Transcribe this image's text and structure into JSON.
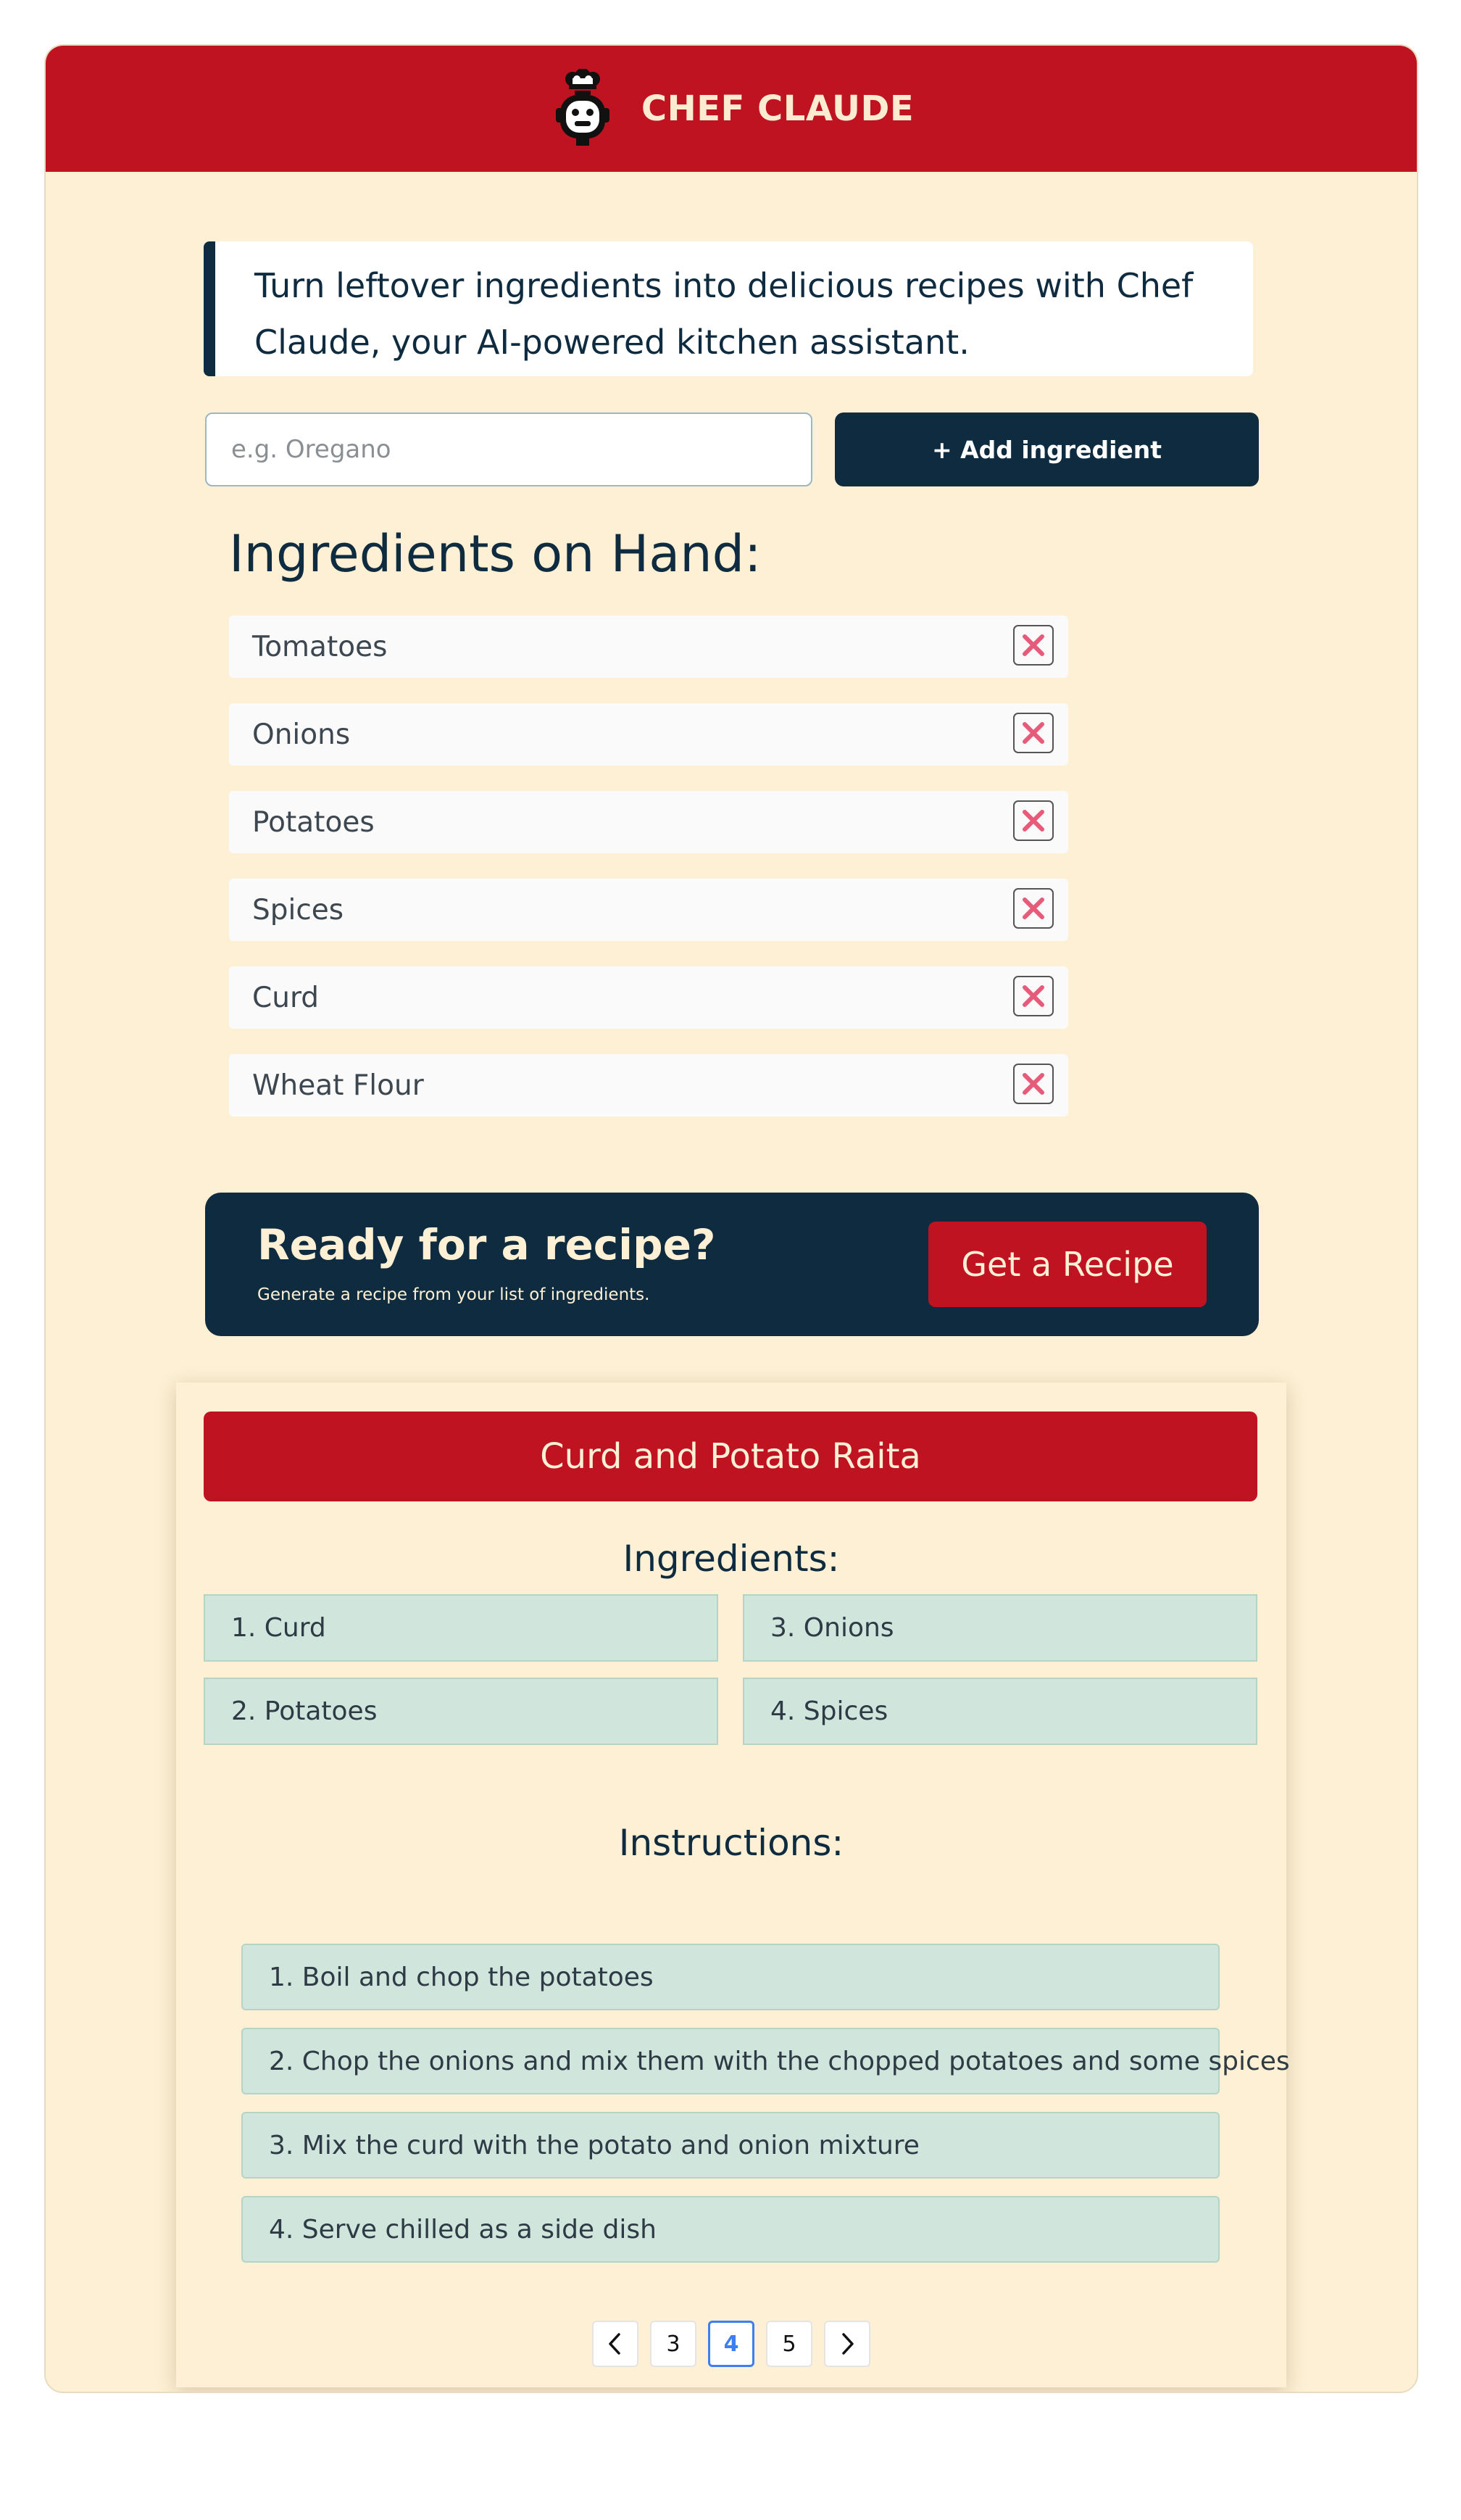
{
  "header": {
    "brand": "CHEF CLAUDE",
    "logo_icon": "chef-robot-icon"
  },
  "intro": {
    "text": "Turn leftover ingredients into delicious recipes with Chef Claude, your AI-powered kitchen assistant."
  },
  "ingredient_form": {
    "placeholder": "e.g. Oregano",
    "value": "",
    "add_label": "+ Add ingredient"
  },
  "on_hand": {
    "title": "Ingredients on Hand:",
    "items": [
      {
        "label": "Tomatoes"
      },
      {
        "label": "Onions"
      },
      {
        "label": "Potatoes"
      },
      {
        "label": "Spices"
      },
      {
        "label": "Curd"
      },
      {
        "label": "Wheat Flour"
      }
    ],
    "remove_icon": "close-icon"
  },
  "cta": {
    "title": "Ready for a recipe?",
    "subtitle": "Generate a recipe from your list of ingredients.",
    "button_label": "Get a Recipe"
  },
  "recipe": {
    "title": "Curd and Potato Raita",
    "ingredients_heading": "Ingredients:",
    "ingredients": [
      "1. Curd",
      "2. Potatoes",
      "3. Onions",
      "4. Spices"
    ],
    "instructions_heading": "Instructions:",
    "instructions": [
      "1. Boil and chop the potatoes",
      "2. Chop the onions and mix them with the chopped potatoes and some spices",
      "3. Mix the curd with the potato and onion mixture",
      "4. Serve chilled as a side dish"
    ]
  },
  "pagination": {
    "pages": [
      "3",
      "4",
      "5"
    ],
    "current": "4"
  },
  "colors": {
    "brand_red": "#c01322",
    "navy": "#0e2b40",
    "cream": "#fdf0d4",
    "tile_green": "#d0e5dc",
    "remove_pink": "#e85a7a",
    "page_active_blue": "#3d7ff0"
  }
}
